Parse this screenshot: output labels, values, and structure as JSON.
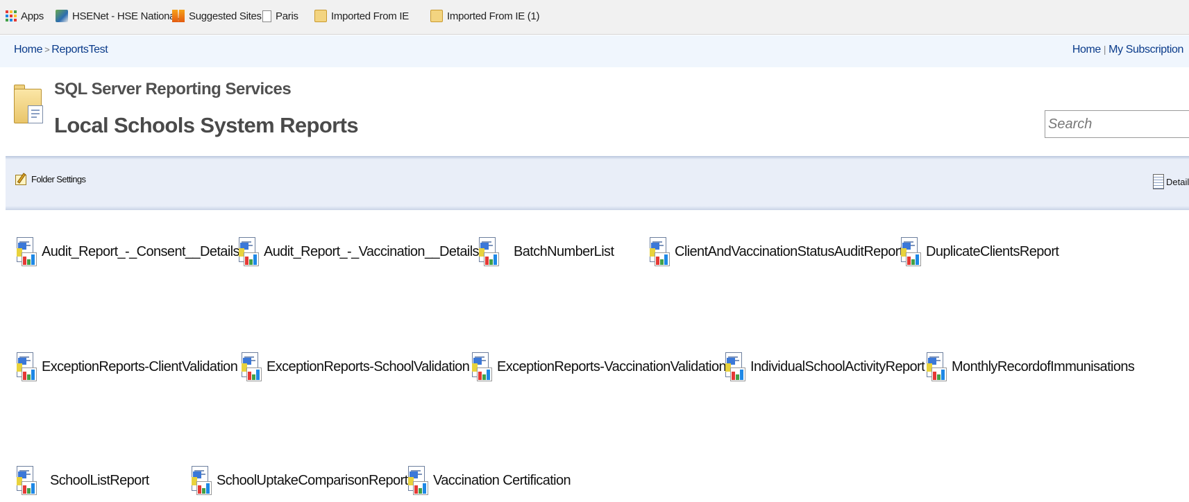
{
  "bookmarks": [
    {
      "label": "Apps",
      "icon": "apps-grid-icon"
    },
    {
      "label": "HSENet - HSE National...",
      "icon": "hsenet-favicon-icon"
    },
    {
      "label": "Suggested Sites",
      "icon": "suggested-sites-icon"
    },
    {
      "label": "Paris",
      "icon": "page-icon"
    },
    {
      "label": "Imported From IE",
      "icon": "folder-icon"
    },
    {
      "label": "Imported From IE (1)",
      "icon": "folder-icon"
    }
  ],
  "breadcrumb": {
    "home": "Home",
    "separator": ">",
    "current": "ReportsTest"
  },
  "top_links": {
    "home": "Home",
    "divider": "|",
    "subscriptions": "My Subscription"
  },
  "header": {
    "subtitle": "SQL Server Reporting Services",
    "title": "Local Schools System Reports"
  },
  "search": {
    "placeholder": "Search"
  },
  "toolbar": {
    "folder_settings": "Folder Settings",
    "details": "Details"
  },
  "reports": [
    "Audit_Report_-_Consent__Details",
    "Audit_Report_-_Vaccination__Details",
    "BatchNumberList",
    "ClientAndVaccinationStatusAuditReport",
    "DuplicateClientsReport",
    "ExceptionReports-ClientValidation",
    "ExceptionReports-SchoolValidation",
    "ExceptionReports-VaccinationValidation",
    "IndividualSchoolActivityReport",
    "MonthlyRecordofImmunisations",
    "SchoolListReport",
    "SchoolUptakeComparisonReport",
    "Vaccination Certification"
  ],
  "colors": {
    "link": "#0a3b8a",
    "breadcrumb_bg": "#f0f6fd",
    "toolbar_bg": "#e9eef8",
    "title_text": "#4a4a4a"
  }
}
